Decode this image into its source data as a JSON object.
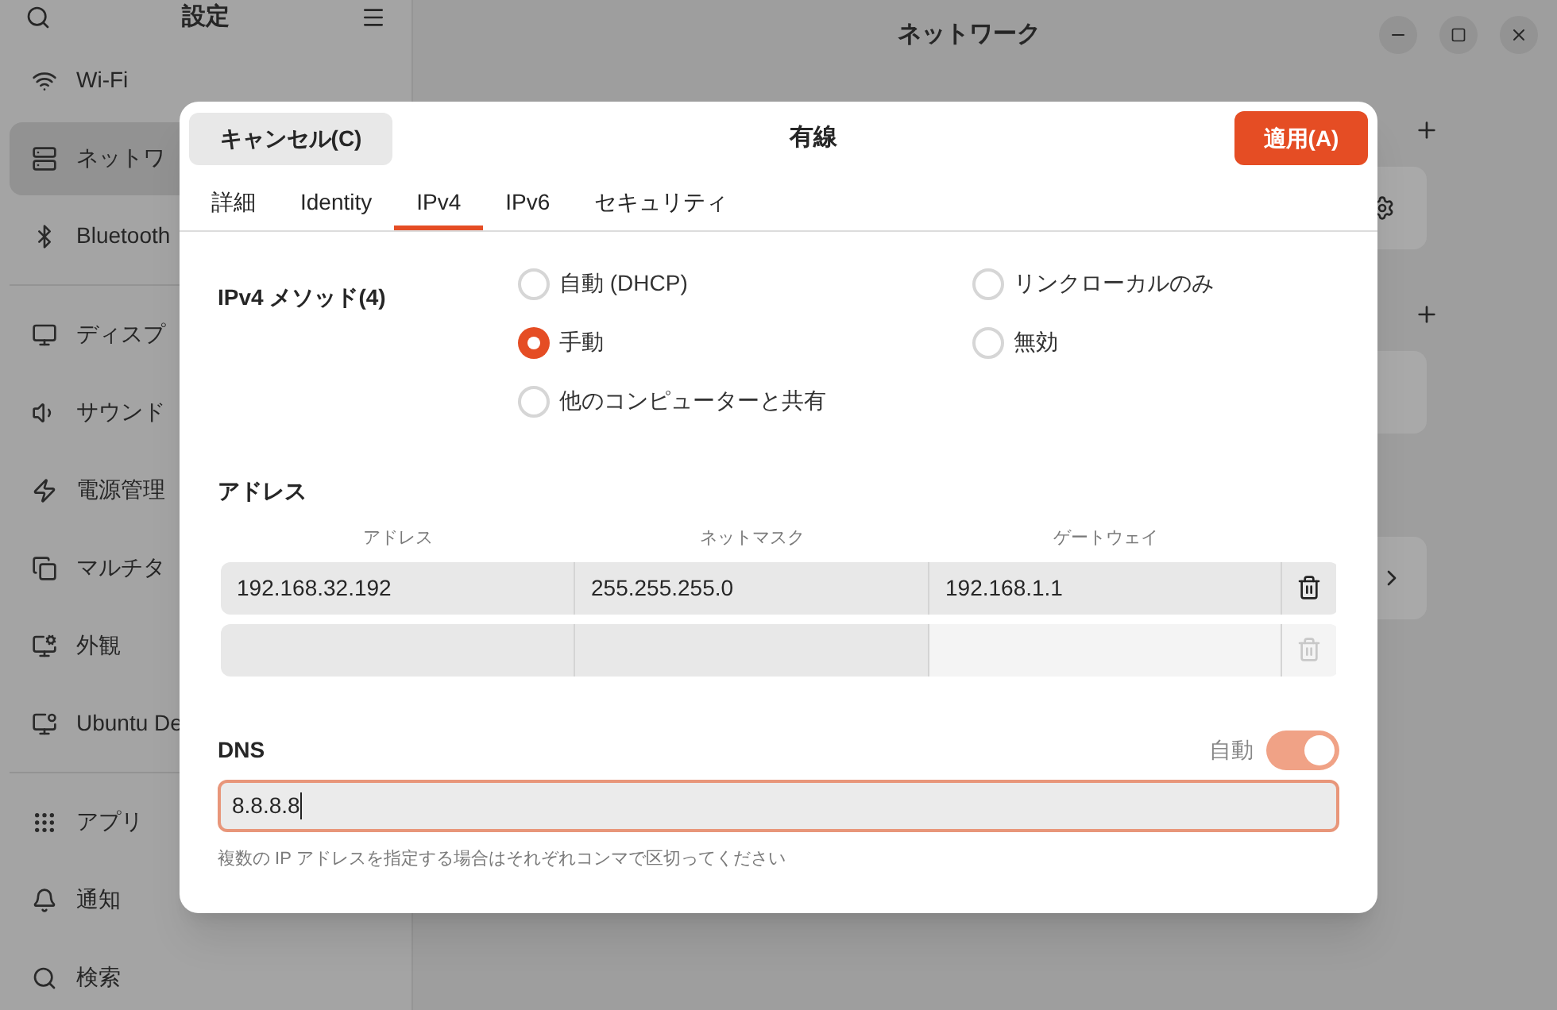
{
  "window": {
    "title": "ネットワーク"
  },
  "sidebar": {
    "title": "設定",
    "groups": [
      [
        {
          "kind": "wifi",
          "label": "Wi-Fi",
          "selected": false
        },
        {
          "kind": "network",
          "label": "ネットワ",
          "selected": true
        },
        {
          "kind": "bluetooth",
          "label": "Bluetooth",
          "selected": false
        }
      ],
      [
        {
          "kind": "display",
          "label": "ディスプ",
          "selected": false
        },
        {
          "kind": "sound",
          "label": "サウンド",
          "selected": false
        },
        {
          "kind": "power",
          "label": "電源管理",
          "selected": false
        },
        {
          "kind": "multitask",
          "label": "マルチタ",
          "selected": false
        },
        {
          "kind": "appearance",
          "label": "外観",
          "selected": false
        },
        {
          "kind": "desktop",
          "label": "Ubuntu De",
          "selected": false
        }
      ],
      [
        {
          "kind": "apps",
          "label": "アプリ",
          "selected": false
        },
        {
          "kind": "notify",
          "label": "通知",
          "selected": false
        },
        {
          "kind": "search",
          "label": "検索",
          "selected": false
        }
      ]
    ]
  },
  "dialog": {
    "title": "有線",
    "cancel": "キャンセル(C)",
    "apply": "適用(A)",
    "tabs": [
      {
        "label": "詳細",
        "selected": false
      },
      {
        "label": "Identity",
        "selected": false
      },
      {
        "label": "IPv4",
        "selected": true
      },
      {
        "label": "IPv6",
        "selected": false
      },
      {
        "label": "セキュリティ",
        "selected": false
      }
    ],
    "method": {
      "label": "IPv4 メソッド(4)",
      "options": [
        {
          "label": "自動 (DHCP)",
          "selected": false
        },
        {
          "label": "リンクローカルのみ",
          "selected": false
        },
        {
          "label": "手動",
          "selected": true
        },
        {
          "label": "無効",
          "selected": false
        },
        {
          "label": "他のコンピューターと共有",
          "selected": false
        }
      ]
    },
    "addresses": {
      "title": "アドレス",
      "columns": [
        "アドレス",
        "ネットマスク",
        "ゲートウェイ"
      ],
      "rows": [
        {
          "cells": [
            "192.168.32.192",
            "255.255.255.0",
            "192.168.1.1"
          ],
          "delete_disabled": false
        },
        {
          "delete_disabled": true
        }
      ]
    },
    "dns": {
      "label": "DNS",
      "auto_label": "自動",
      "auto": true,
      "value": "8.8.8.8",
      "hint": "複数の IP アドレスを指定する場合はそれぞれコンマで区切ってください"
    }
  }
}
